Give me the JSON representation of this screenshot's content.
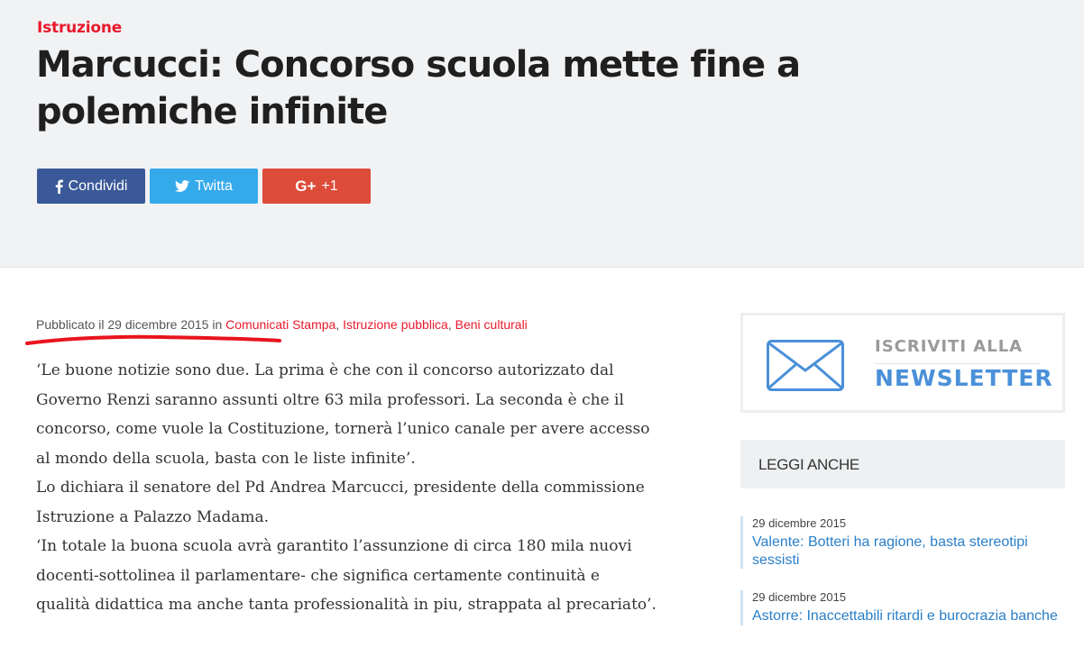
{
  "header": {
    "category": "Istruzione",
    "title": "Marcucci: Concorso scuola mette fine a polemiche infinite"
  },
  "share": {
    "facebook_label": "Condividi",
    "twitter_label": "Twitta",
    "gplus_label": "+1",
    "gplus_icon_text": "G+",
    "icons": [
      "facebook-icon",
      "twitter-icon",
      "google-plus-icon"
    ],
    "colors": {
      "facebook": "#3b5998",
      "twitter": "#35aaeb",
      "gplus": "#dd4b39"
    }
  },
  "meta": {
    "published_prefix": "Pubblicato il",
    "date": "29 dicembre 2015",
    "in": "in",
    "categories": [
      "Comunicati Stampa",
      "Istruzione pubblica",
      "Beni culturali"
    ],
    "separator": ", "
  },
  "article": {
    "paragraphs": [
      "‘Le buone notizie sono due. La prima è che con il concorso autorizzato dal Governo Renzi saranno assunti oltre 63 mila professori. La seconda è che il concorso, come vuole la Costituzione, tornerà l’unico canale per avere accesso al mondo della scuola, basta con le liste infinite’.",
      "Lo dichiara il senatore del Pd Andrea Marcucci, presidente della commissione Istruzione a Palazzo Madama.",
      "‘In totale la buona scuola avrà garantito l’assunzione di circa 180 mila nuovi docenti-sottolinea il parlamentare- che significa certamente continuità e qualità didattica ma anche tanta professionalità in piu, strappata al precariato’."
    ]
  },
  "sidebar": {
    "newsletter": {
      "line1": "ISCRIVITI ALLA",
      "line2": "NEWSLETTER",
      "icon": "envelope-icon",
      "accent": "#4a90d9"
    },
    "leggi_anche": "LEGGI ANCHE",
    "related": [
      {
        "date": "29 dicembre 2015",
        "title": "Valente: Botteri ha ragione, basta stereotipi sessisti"
      },
      {
        "date": "29 dicembre 2015",
        "title": "Astorre: Inaccettabili ritardi e burocrazia banche"
      }
    ]
  },
  "colors": {
    "brand_red": "#e8192c",
    "link_blue": "#2a7fc7",
    "hero_bg": "#f1f2f4"
  }
}
